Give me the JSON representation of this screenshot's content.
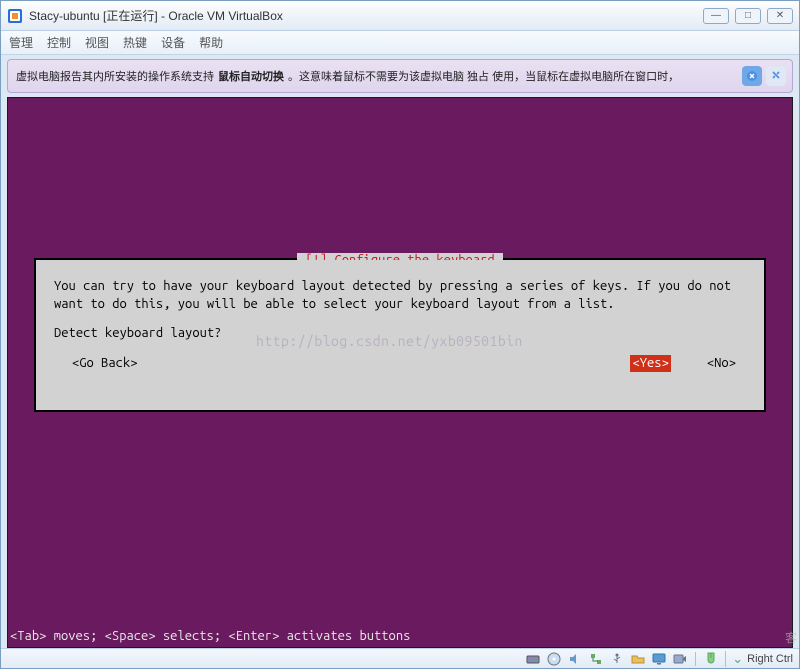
{
  "window": {
    "title": "Stacy-ubuntu [正在运行] - Oracle VM VirtualBox",
    "controls": {
      "min": "—",
      "max": "□",
      "close": "✕"
    }
  },
  "menu": {
    "items": [
      "管理",
      "控制",
      "视图",
      "热键",
      "设备",
      "帮助"
    ]
  },
  "notification": {
    "prefix": "虚拟电脑报告其内所安装的操作系统支持 ",
    "bold": "鼠标自动切换",
    "suffix": "。这意味着鼠标不需要为该虚拟电脑 独占 使用，当鼠标在虚拟电脑所在窗口时，"
  },
  "dialog": {
    "title": "[!] Configure the keyboard",
    "body": "You can try to have your keyboard layout detected by pressing a series of keys. If you do not want to do this, you will be able to select your keyboard layout from a list.",
    "question": "Detect keyboard layout?",
    "go_back": "<Go Back>",
    "yes": "<Yes>",
    "no": "<No>"
  },
  "watermark": "http://blog.csdn.net/yxb09501bin",
  "help_line": "<Tab> moves; <Space> selects; <Enter> activates buttons",
  "statusbar": {
    "host_key": "Right Ctrl"
  },
  "right_watermark": "客"
}
